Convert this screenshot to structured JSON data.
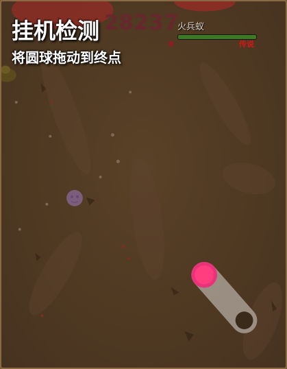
{
  "hud": {
    "score": "28237",
    "title": "挂机检测",
    "instruction": "将圆球拖动到终点"
  },
  "boss": {
    "name": "火兵蚁",
    "tag": "传说",
    "health_fraction": 1.0
  },
  "colors": {
    "ground": "#4f3922",
    "ball": "#ff3d7f",
    "target": "#3a2a1a",
    "track": "#a89e95",
    "health": "#3c7a22"
  }
}
